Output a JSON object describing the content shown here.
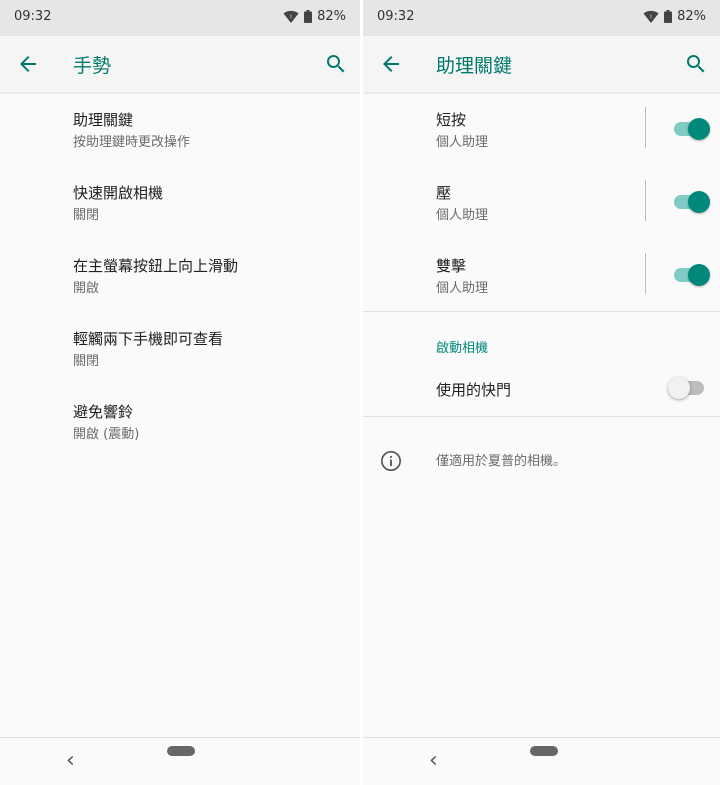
{
  "status_bar": {
    "time": "09:32",
    "battery": "82%"
  },
  "left": {
    "title": "手勢",
    "items": [
      {
        "title": "助理關鍵",
        "subtitle": "按助理鍵時更改操作"
      },
      {
        "title": "快速開啟相機",
        "subtitle": "關閉"
      },
      {
        "title": "在主螢幕按鈕上向上滑動",
        "subtitle": "開啟"
      },
      {
        "title": "輕觸兩下手機即可查看",
        "subtitle": "關閉"
      },
      {
        "title": "避免響鈴",
        "subtitle": "開啟 (震動)"
      }
    ]
  },
  "right": {
    "title": "助理關鍵",
    "items": [
      {
        "title": "短按",
        "subtitle": "個人助理",
        "enabled": true
      },
      {
        "title": "壓",
        "subtitle": "個人助理",
        "enabled": true
      },
      {
        "title": "雙擊",
        "subtitle": "個人助理",
        "enabled": true
      }
    ],
    "category": "啟動相機",
    "shutter": {
      "title": "使用的快門",
      "enabled": false
    },
    "info": "僅適用於夏普的相機。"
  },
  "icons": {
    "back": "arrow-back-icon",
    "search": "search-icon",
    "wifi": "wifi-icon",
    "battery": "battery-icon",
    "info": "info-icon"
  },
  "colors": {
    "accent": "#00796b",
    "switch_on": "#00897b"
  }
}
